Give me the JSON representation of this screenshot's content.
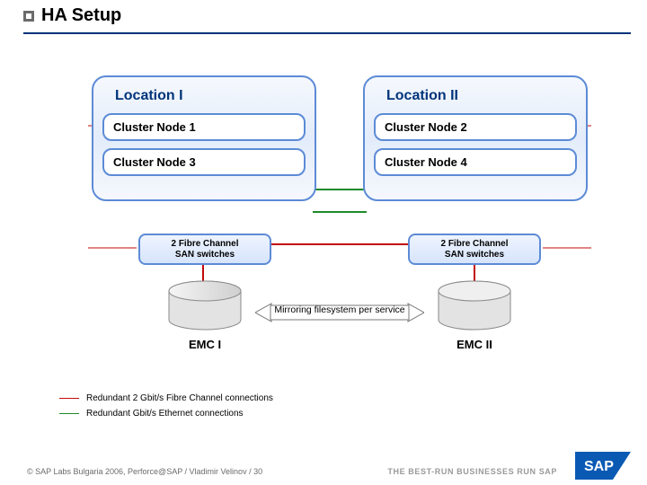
{
  "page": {
    "title": "HA Setup"
  },
  "diagram": {
    "locations": {
      "left": {
        "title": "Location I",
        "node_top": "Cluster Node 1",
        "node_bottom": "Cluster Node 3"
      },
      "right": {
        "title": "Location II",
        "node_top": "Cluster Node 2",
        "node_bottom": "Cluster Node 4"
      }
    },
    "switches": {
      "left_line1": "2 Fibre Channel",
      "left_line2": "SAN switches",
      "right_line1": "2 Fibre Channel",
      "right_line2": "SAN switches"
    },
    "storage": {
      "left_label": "EMC I",
      "right_label": "EMC II"
    },
    "mirror_label": "Mirroring filesystem per service"
  },
  "legend": {
    "fibre_channel": "Redundant 2 Gbit/s Fibre Channel connections",
    "ethernet": "Redundant Gbit/s Ethernet connections"
  },
  "footer": {
    "copyright": "© SAP Labs Bulgaria 2006, Perforce@SAP / Vladimir Velinov / 30",
    "tagline": "THE BEST-RUN BUSINESSES RUN SAP",
    "brand": "SAP"
  },
  "colors": {
    "accent": "#00347a",
    "node_border": "#5c8bd6",
    "fc": "#c30a0a",
    "eth": "#1e8a2a"
  }
}
